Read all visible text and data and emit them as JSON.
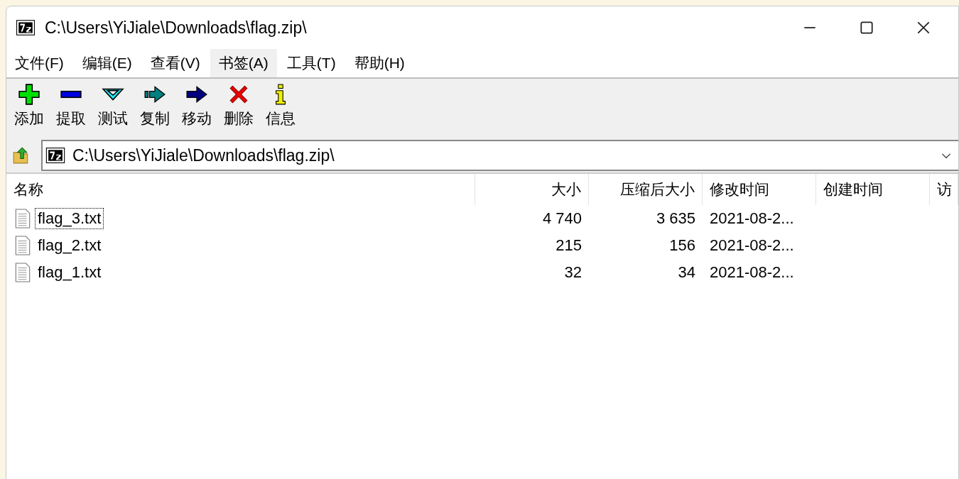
{
  "window": {
    "title": "C:\\Users\\YiJiale\\Downloads\\flag.zip\\"
  },
  "menu": [
    {
      "label": "文件(F)",
      "hovered": false
    },
    {
      "label": "编辑(E)",
      "hovered": false
    },
    {
      "label": "查看(V)",
      "hovered": false
    },
    {
      "label": "书签(A)",
      "hovered": true
    },
    {
      "label": "工具(T)",
      "hovered": false
    },
    {
      "label": "帮助(H)",
      "hovered": false
    }
  ],
  "toolbar": [
    {
      "kind": "add",
      "label": "添加"
    },
    {
      "kind": "extract",
      "label": "提取"
    },
    {
      "kind": "test",
      "label": "测试"
    },
    {
      "kind": "copy",
      "label": "复制"
    },
    {
      "kind": "move",
      "label": "移动"
    },
    {
      "kind": "delete",
      "label": "删除"
    },
    {
      "kind": "info",
      "label": "信息"
    }
  ],
  "address": {
    "value": "C:\\Users\\YiJiale\\Downloads\\flag.zip\\"
  },
  "table": {
    "columns": [
      "名称",
      "大小",
      "压缩后大小",
      "修改时间",
      "创建时间",
      "访"
    ],
    "rows": [
      {
        "focused": true,
        "cells": [
          "flag_3.txt",
          "4 740",
          "3 635",
          "2021-08-2..."
        ]
      },
      {
        "focused": false,
        "cells": [
          "flag_2.txt",
          "215",
          "156",
          "2021-08-2..."
        ]
      },
      {
        "focused": false,
        "cells": [
          "flag_1.txt",
          "32",
          "34",
          "2021-08-2..."
        ]
      }
    ]
  }
}
